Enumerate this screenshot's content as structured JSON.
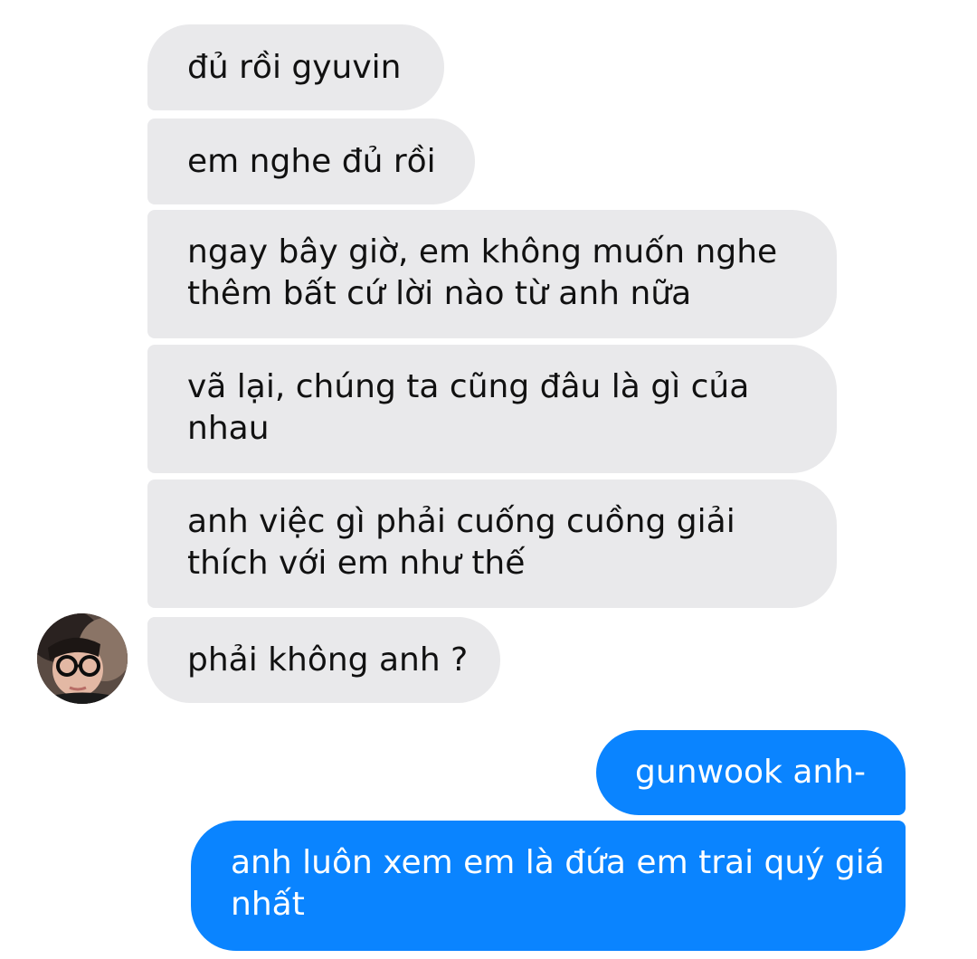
{
  "conversation": {
    "received": [
      {
        "lines": [
          "đủ rồi gyuvin"
        ]
      },
      {
        "lines": [
          "em nghe đủ rồi"
        ]
      },
      {
        "lines": [
          "ngay bây giờ, em không muốn nghe",
          "thêm bất cứ lời nào từ anh nữa"
        ]
      },
      {
        "lines": [
          "vã lại, chúng ta cũng đâu là gì của",
          "nhau"
        ]
      },
      {
        "lines": [
          "anh việc gì phải cuống cuồng giải",
          "thích với em như thế"
        ]
      },
      {
        "lines": [
          "phải không anh ?"
        ]
      }
    ],
    "sent": [
      {
        "lines": [
          "gunwook anh-"
        ]
      },
      {
        "lines": [
          "anh luôn xem em là đứa em trai quý giá",
          "nhất"
        ]
      }
    ]
  },
  "colors": {
    "received_bubble": "#e9e9eb",
    "sent_bubble": "#0a84ff",
    "received_text": "#111111",
    "sent_text": "#ffffff"
  },
  "icons": {
    "avatar": "contact-avatar-photo"
  }
}
